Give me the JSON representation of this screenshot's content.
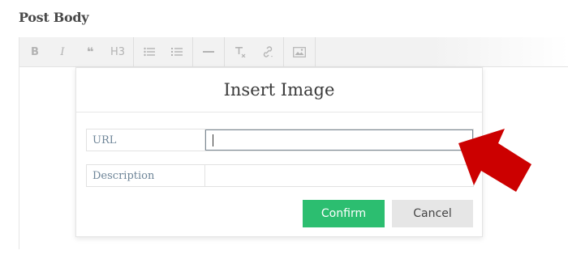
{
  "section": {
    "title": "Post Body"
  },
  "toolbar": {
    "bold_label": "B",
    "italic_label": "I",
    "quote_label": "❝",
    "heading_label": "H3",
    "icons": [
      "bold-icon",
      "italic-icon",
      "quote-icon",
      "heading-icon",
      "bulleted-list-icon",
      "numbered-list-icon",
      "horizontal-rule-icon",
      "clear-format-icon",
      "link-icon",
      "image-icon"
    ]
  },
  "modal": {
    "title": "Insert Image",
    "url_label": "URL",
    "url_value": "",
    "description_label": "Description",
    "description_value": "",
    "confirm_label": "Confirm",
    "cancel_label": "Cancel"
  },
  "colors": {
    "confirm": "#2cbe70",
    "cancel": "#e6e6e6",
    "arrow": "#cc0000",
    "label": "#6e8598"
  }
}
